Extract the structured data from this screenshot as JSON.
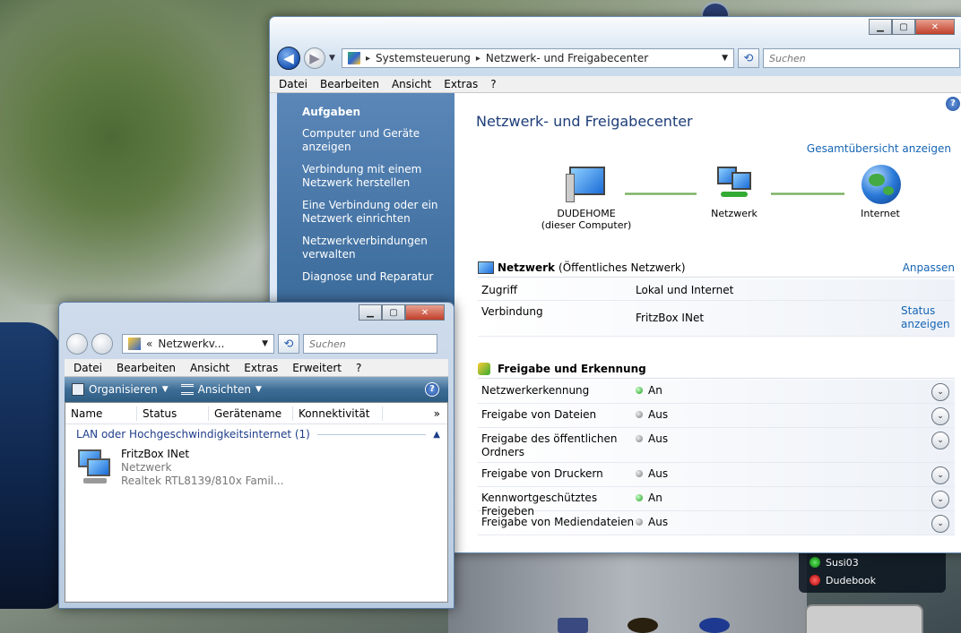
{
  "desktop": {
    "gadget_contacts": [
      "Susi03",
      "Dudebook"
    ]
  },
  "main_window": {
    "address": {
      "segments": [
        "Systemsteuerung",
        "Netzwerk- und Freigabecenter"
      ],
      "search_placeholder": "Suchen"
    },
    "menu": [
      "Datei",
      "Bearbeiten",
      "Ansicht",
      "Extras",
      "?"
    ],
    "tasks": {
      "heading": "Aufgaben",
      "items": [
        "Computer und Geräte anzeigen",
        "Verbindung mit einem Netzwerk herstellen",
        "Eine Verbindung oder ein Netzwerk einrichten",
        "Netzwerkverbindungen verwalten",
        "Diagnose und Reparatur"
      ]
    },
    "content": {
      "title": "Netzwerk- und Freigabecenter",
      "overview_link": "Gesamtübersicht anzeigen",
      "map": {
        "computer_name": "DUDEHOME",
        "computer_sub": "(dieser Computer)",
        "network": "Netzwerk",
        "internet": "Internet"
      },
      "network_section": {
        "title": "Netzwerk",
        "type": "(Öffentliches Netzwerk)",
        "customize": "Anpassen",
        "access_label": "Zugriff",
        "access_value": "Lokal und Internet",
        "connection_label": "Verbindung",
        "connection_value": "FritzBox INet",
        "status_link": "Status anzeigen"
      },
      "sharing_section": {
        "title": "Freigabe und Erkennung",
        "rows": [
          {
            "label": "Netzwerkerkennung",
            "state": "An",
            "on": true
          },
          {
            "label": "Freigabe von Dateien",
            "state": "Aus",
            "on": false
          },
          {
            "label": "Freigabe des öffentlichen Ordners",
            "state": "Aus",
            "on": false
          },
          {
            "label": "Freigabe von Druckern",
            "state": "Aus",
            "on": false
          },
          {
            "label": "Kennwortgeschütztes Freigeben",
            "state": "An",
            "on": true
          },
          {
            "label": "Freigabe von Mediendateien",
            "state": "Aus",
            "on": false
          }
        ]
      }
    }
  },
  "sub_window": {
    "address": "Netzwerkv...",
    "address_prefix": "«",
    "search_placeholder": "Suchen",
    "menu": [
      "Datei",
      "Bearbeiten",
      "Ansicht",
      "Extras",
      "Erweitert",
      "?"
    ],
    "commands": {
      "organize": "Organisieren",
      "views": "Ansichten"
    },
    "columns": [
      "Name",
      "Status",
      "Gerätename",
      "Konnektivität"
    ],
    "more_columns": "»",
    "group": "LAN oder Hochgeschwindigkeitsinternet (1)",
    "item": {
      "name": "FritzBox INet",
      "network": "Netzwerk",
      "device": "Realtek RTL8139/810x Famil..."
    }
  },
  "colors": {
    "link": "#1464b4",
    "title": "#1e3d78",
    "task_pane": "#3f6f9f",
    "led_on": "#1a9a1a"
  }
}
